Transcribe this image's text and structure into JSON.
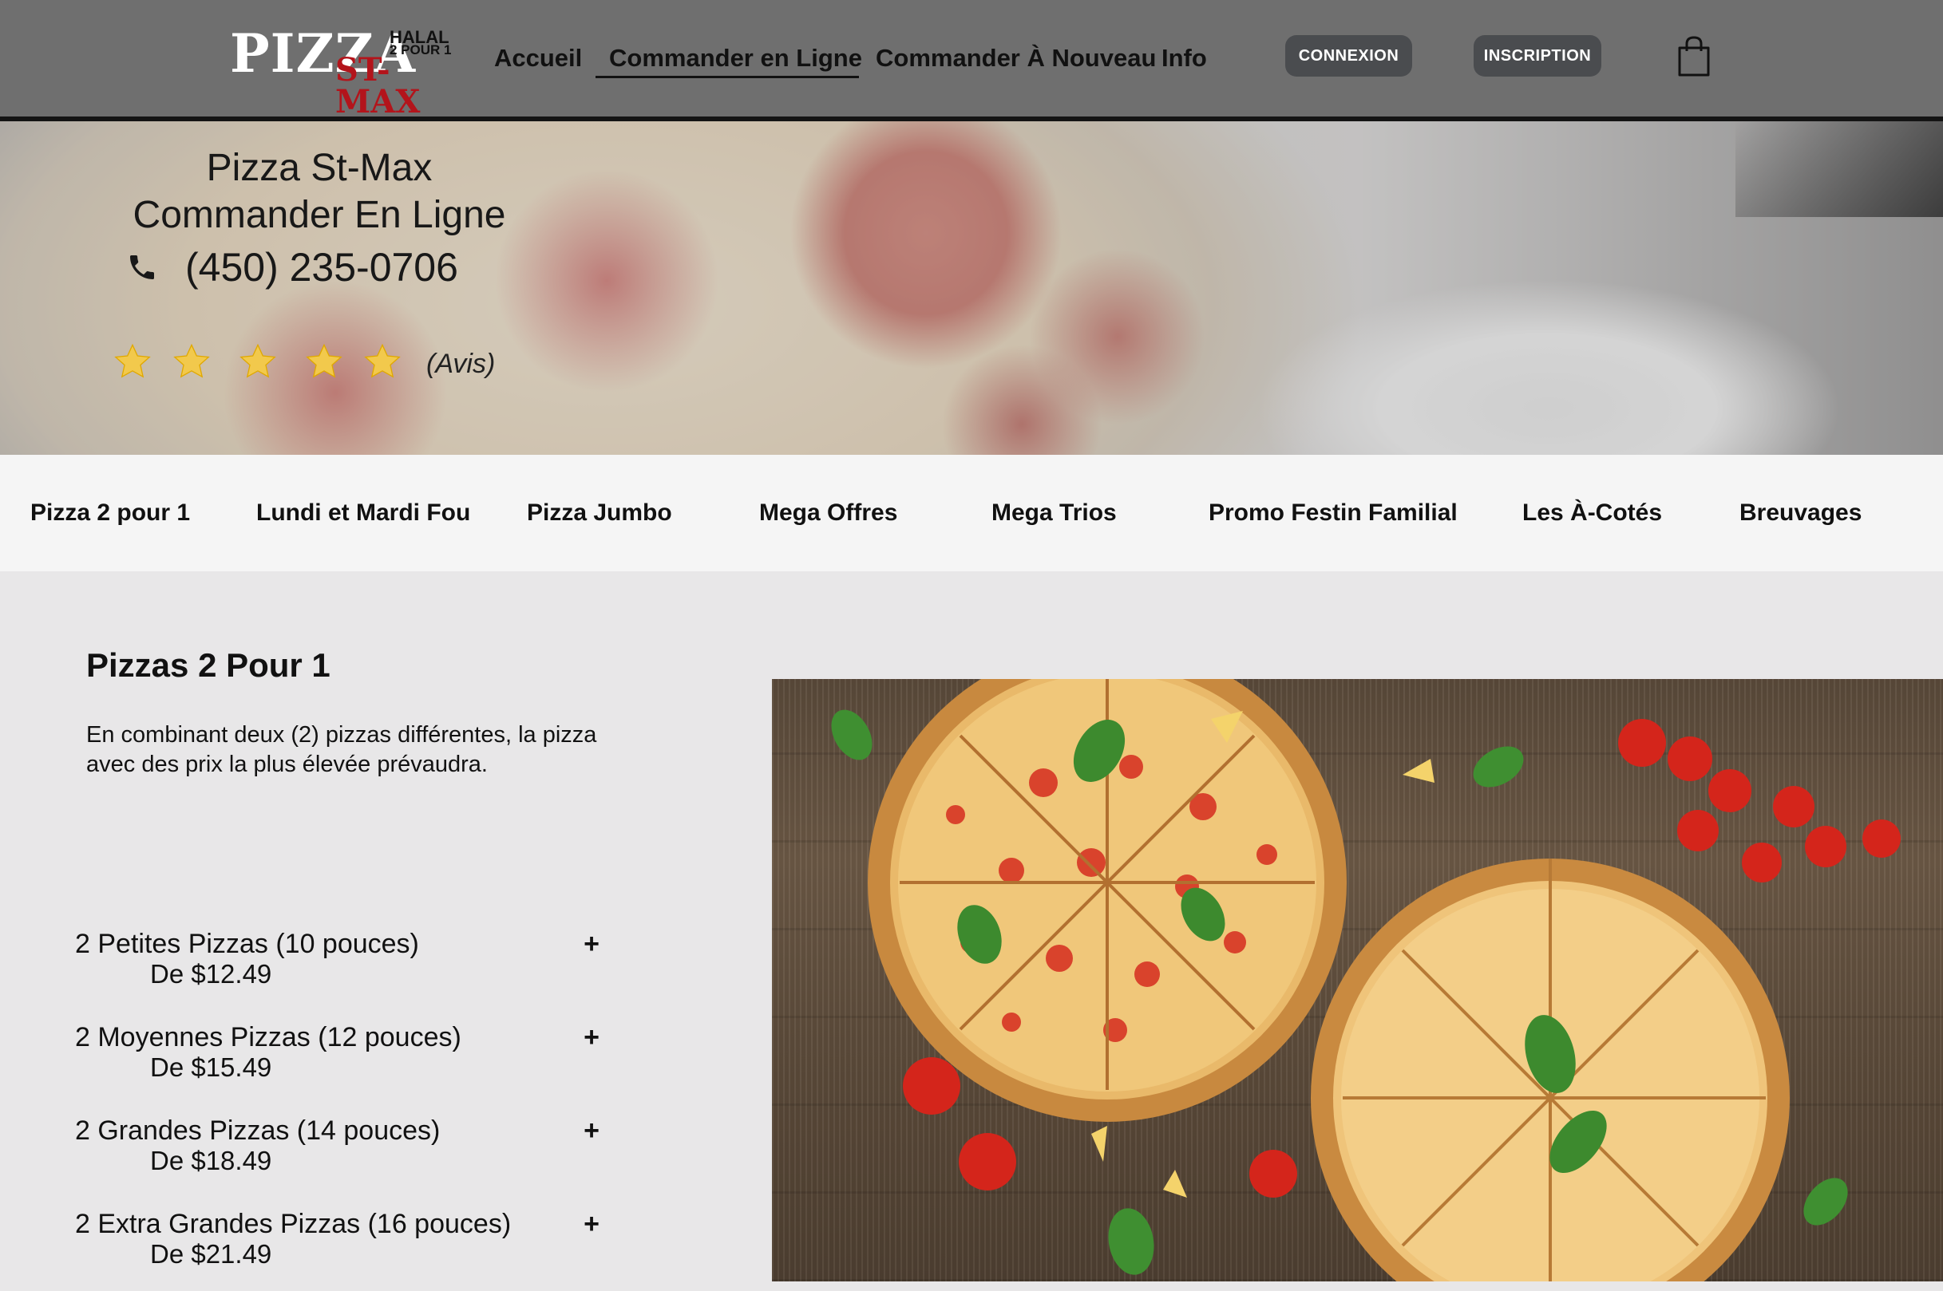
{
  "header": {
    "logo": {
      "word": "PIZZA",
      "halal": "HALAL",
      "deux_pour_un": "2 POUR 1",
      "name": "ST-MAX"
    },
    "nav": [
      {
        "label": "Accueil"
      },
      {
        "label": "Commander en Ligne",
        "active": true
      },
      {
        "label": "Commander À Nouveau"
      },
      {
        "label": "Info"
      }
    ],
    "login_label": "CONNEXION",
    "signup_label": "INSCRIPTION",
    "cart_icon": "shopping-bag-icon"
  },
  "hero": {
    "title_line1": "Pizza St-Max",
    "title_line2": "Commander En Ligne",
    "phone": "(450) 235-0706",
    "phone_icon": "phone-icon",
    "rating": {
      "stars": 5,
      "max": 5,
      "avis_label": "(Avis)"
    },
    "star_color": "#f2c94c"
  },
  "categories": [
    "Pizza 2 pour 1",
    "Lundi et Mardi Fou",
    "Pizza Jumbo",
    "Mega Offres",
    "Mega Trios",
    "Promo Festin Familial",
    "Les À-Cotés",
    "Breuvages"
  ],
  "section": {
    "title": "Pizzas 2 Pour 1",
    "description": "En combinant deux (2) pizzas différentes, la pizza avec des prix la plus élevée prévaudra.",
    "items": [
      {
        "name": "2 Petites Pizzas (10 pouces)",
        "price": "De $12.49",
        "action": "+"
      },
      {
        "name": "2 Moyennes Pizzas (12 pouces)",
        "price": "De $15.49",
        "action": "+"
      },
      {
        "name": "2 Grandes Pizzas (14 pouces)",
        "price": "De $18.49",
        "action": "+"
      },
      {
        "name": "2 Extra Grandes Pizzas (16 pouces)",
        "price": "De $21.49",
        "action": "+"
      }
    ]
  },
  "colors": {
    "header_bg": "#6f6f6f",
    "button_bg": "#4a4c4f",
    "category_bar_bg": "#f5f5f5",
    "content_bg": "#e8e7e8",
    "logo_red": "#b3141b"
  }
}
